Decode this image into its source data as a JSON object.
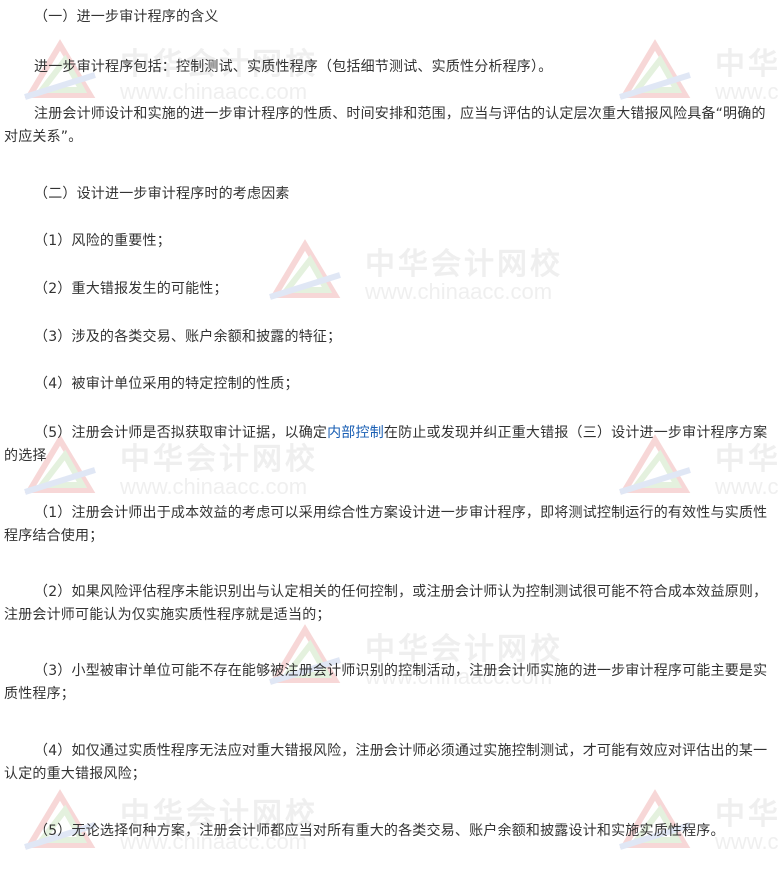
{
  "watermark": {
    "name_cn": "中华会计网校",
    "url": "www.chinaacc.com",
    "colors": {
      "red": "#f2b8b8",
      "green": "#cfe6c4",
      "blue": "#c7d4ee",
      "text": "#e3e3e3"
    }
  },
  "document": {
    "heading_1": "（一）进一步审计程序的含义",
    "para_1": "进一步审计程序包括：控制测试、实质性程序（包括细节测试、实质性分析程序）。",
    "para_2": "注册会计师设计和实施的进一步审计程序的性质、时间安排和范围，应当与评估的认定层次重大错报风险具备“明确的对应关系”。",
    "heading_2": "（二）设计进一步审计程序时的考虑因素",
    "factors": [
      "（1）风险的重要性；",
      "（2）重大错报发生的可能性；",
      "（3）涉及的各类交易、账户余额和披露的特征；",
      "（4）被审计单位采用的特定控制的性质；"
    ],
    "factor_5_before": "（5）注册会计师是否拟获取审计证据，以确定",
    "factor_5_link": "内部控制",
    "factor_5_after": "在防止或发现并纠正重大错报（三）设计进一步审计程序方案的选择",
    "choices": [
      "（1）注册会计师出于成本效益的考虑可以采用综合性方案设计进一步审计程序，即将测试控制运行的有效性与实质性程序结合使用；",
      "（2）如果风险评估程序未能识别出与认定相关的任何控制，或注册会计师认为控制测试很可能不符合成本效益原则，注册会计师可能认为仅实施实质性程序就是适当的；",
      "（3）小型被审计单位可能不存在能够被注册会计师识别的控制活动，注册会计师实施的进一步审计程序可能主要是实质性程序；",
      "（4）如仅通过实质性程序无法应对重大错报风险，注册会计师必须通过实施控制测试，才可能有效应对评估出的某一认定的重大错报风险；",
      "（5）无论选择何种方案，注册会计师都应当对所有重大的各类交易、账户余额和披露设计和实施实质性程序。"
    ]
  }
}
